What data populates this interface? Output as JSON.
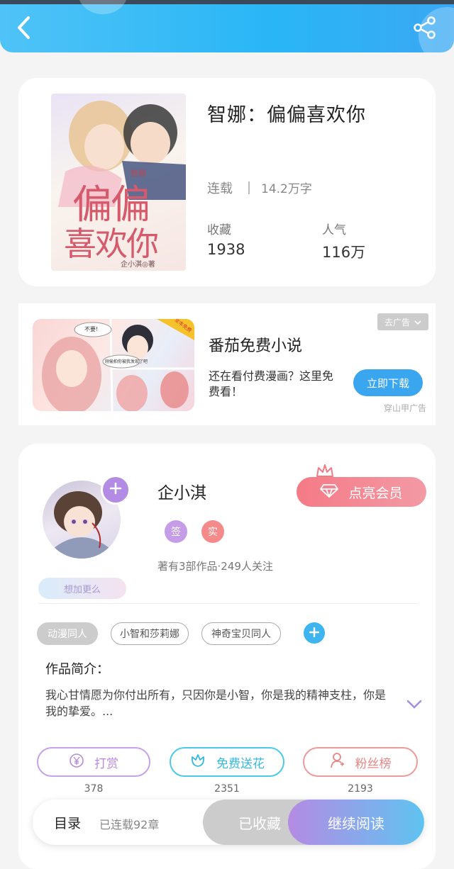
{
  "nav": {
    "back_icon": "chevron-left-icon",
    "share_icon": "share-icon"
  },
  "book": {
    "cover_title_small": "智娜",
    "cover_title_line1": "偏偏",
    "cover_title_line2": "喜欢你",
    "cover_author": "企小淇◎著",
    "title": "智娜：偏偏喜欢你",
    "status": "连载",
    "word_count": "14.2万字",
    "favorites_label": "收藏",
    "favorites_value": "1938",
    "popularity_label": "人气",
    "popularity_value": "116万"
  },
  "ad": {
    "remove_label": "去广告",
    "title": "番茄免费小说",
    "desc": "还在看付费漫画？这里免费看！",
    "button": "立即下载",
    "source": "穿山甲广告",
    "bubble1": "不要!",
    "bubble2": "刚偷拍你被我发现了吧",
    "corner_badge": "全本免费"
  },
  "author": {
    "name": "企小淇",
    "badge1": "签",
    "badge2": "实",
    "stats": "著有3部作品·249人关注",
    "vip_button": "点亮会员",
    "want_more": "想加更么",
    "tags": [
      "动漫同人",
      "小智和莎莉娜",
      "神奇宝贝同人"
    ],
    "intro_label": "作品简介：",
    "intro_text": "我心甘情愿为你付出所有，只因你是小智，你是我的精神支柱，你是我的挚爱。..."
  },
  "actions": [
    {
      "label": "打赏",
      "count": "378",
      "color": "#b98be0"
    },
    {
      "label": "免费送花",
      "count": "2351",
      "color": "#4cc9e8"
    },
    {
      "label": "粉丝榜",
      "count": "2193",
      "color": "#ee8a8a"
    }
  ],
  "bottom": {
    "toc": "目录",
    "chapters": "已连载92章",
    "collected": "已收藏",
    "continue": "继续阅读"
  }
}
